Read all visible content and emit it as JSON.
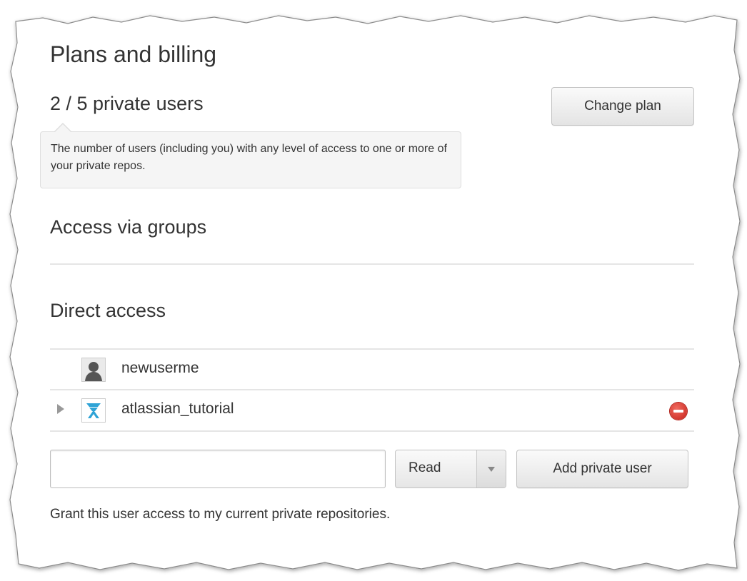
{
  "page": {
    "title": "Plans and billing"
  },
  "plan": {
    "count_label": "2 / 5 private users",
    "change_label": "Change plan",
    "tooltip": "The number of users (including you) with any level of access to one or more of your private repos."
  },
  "sections": {
    "groups_heading": "Access via groups",
    "direct_heading": "Direct access"
  },
  "users": [
    {
      "name": "newuserme",
      "avatar": "person-avatar-icon",
      "expandable": false,
      "removable": false
    },
    {
      "name": "atlassian_tutorial",
      "avatar": "atlassian-logo-icon",
      "expandable": true,
      "removable": true
    }
  ],
  "add_user": {
    "input_value": "",
    "permission": "Read",
    "button_label": "Add private user",
    "help": "Grant this user access to my current private repositories."
  },
  "colors": {
    "remove": "#d9342b",
    "atlassian": "#2ea3d6",
    "text": "#333333"
  }
}
